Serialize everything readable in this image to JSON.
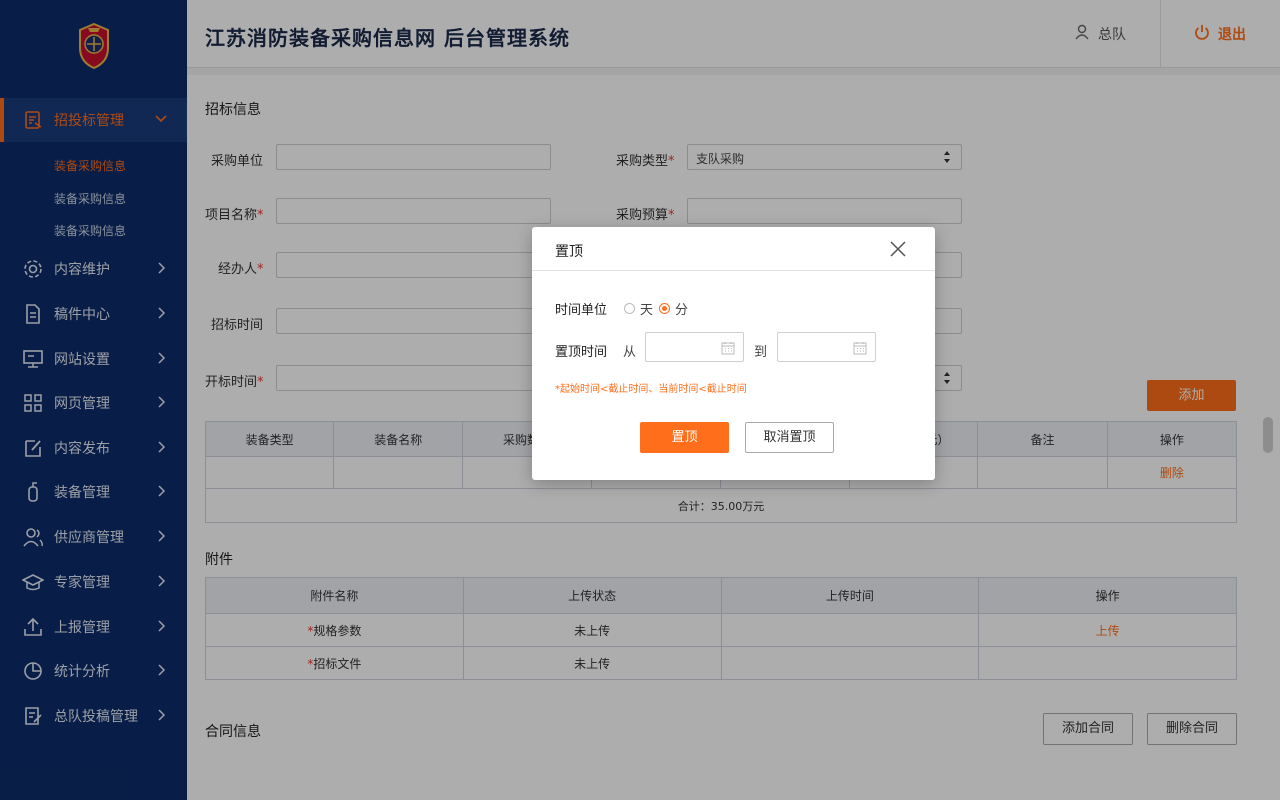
{
  "header": {
    "site_title": "江苏消防装备采购信息网  后台管理系统",
    "user_name": "总队",
    "logout_label": "退出"
  },
  "sidebar": {
    "items": [
      {
        "label": "招投标管理",
        "icon": "bid-doc-icon"
      },
      {
        "label": "内容维护",
        "icon": "gear-icon"
      },
      {
        "label": "稿件中心",
        "icon": "document-icon"
      },
      {
        "label": "网站设置",
        "icon": "monitor-icon"
      },
      {
        "label": "网页管理",
        "icon": "grid-icon"
      },
      {
        "label": "内容发布",
        "icon": "edit-icon"
      },
      {
        "label": "装备管理",
        "icon": "extinguisher-icon"
      },
      {
        "label": "供应商管理",
        "icon": "users-icon"
      },
      {
        "label": "专家管理",
        "icon": "graduation-cap-icon"
      },
      {
        "label": "上报管理",
        "icon": "upload-icon"
      },
      {
        "label": "统计分析",
        "icon": "pie-chart-icon"
      },
      {
        "label": "总队投稿管理",
        "icon": "list-edit-icon"
      }
    ],
    "sub_items": [
      "装备采购信息",
      "装备采购信息",
      "装备采购信息"
    ]
  },
  "form": {
    "section_title": "招标信息",
    "purchase_unit_label": "采购单位",
    "purchase_type_label": "采购类型",
    "purchase_type_value": "支队采购",
    "project_name_label": "项目名称",
    "budget_label": "采购预算",
    "handler_label": "经办人",
    "bid_time_label": "招标时间",
    "open_time_label": "开标时间",
    "add_button": "添加"
  },
  "equipment_table": {
    "headers": [
      "装备类型",
      "装备名称",
      "采购数量",
      "",
      "",
      "计（万元）",
      "备注",
      "操作"
    ],
    "row_action": "删除",
    "total": "合计：35.00万元"
  },
  "attachments": {
    "section_title": "附件",
    "headers": [
      "附件名称",
      "上传状态",
      "上传时间",
      "操作"
    ],
    "rows": [
      {
        "name": "规格参数",
        "status": "未上传",
        "time": "",
        "action": "上传"
      },
      {
        "name": "招标文件",
        "status": "未上传",
        "time": "",
        "action": ""
      }
    ]
  },
  "contract": {
    "section_title": "合同信息",
    "add_button": "添加合同",
    "delete_button": "删除合同"
  },
  "modal": {
    "title": "置顶",
    "time_unit_label": "时间单位",
    "unit_day": "天",
    "unit_minute": "分",
    "selected_unit": "分",
    "pin_time_label": "置顶时间",
    "from_label": "从",
    "to_label": "到",
    "hint": "*起始时间<截止时间、当前时间<截止时间",
    "confirm_button": "置顶",
    "cancel_button": "取消置顶"
  },
  "colors": {
    "accent": "#ff6e1a",
    "sidebar_bg": "#0c2c69",
    "required": "#e33333"
  }
}
